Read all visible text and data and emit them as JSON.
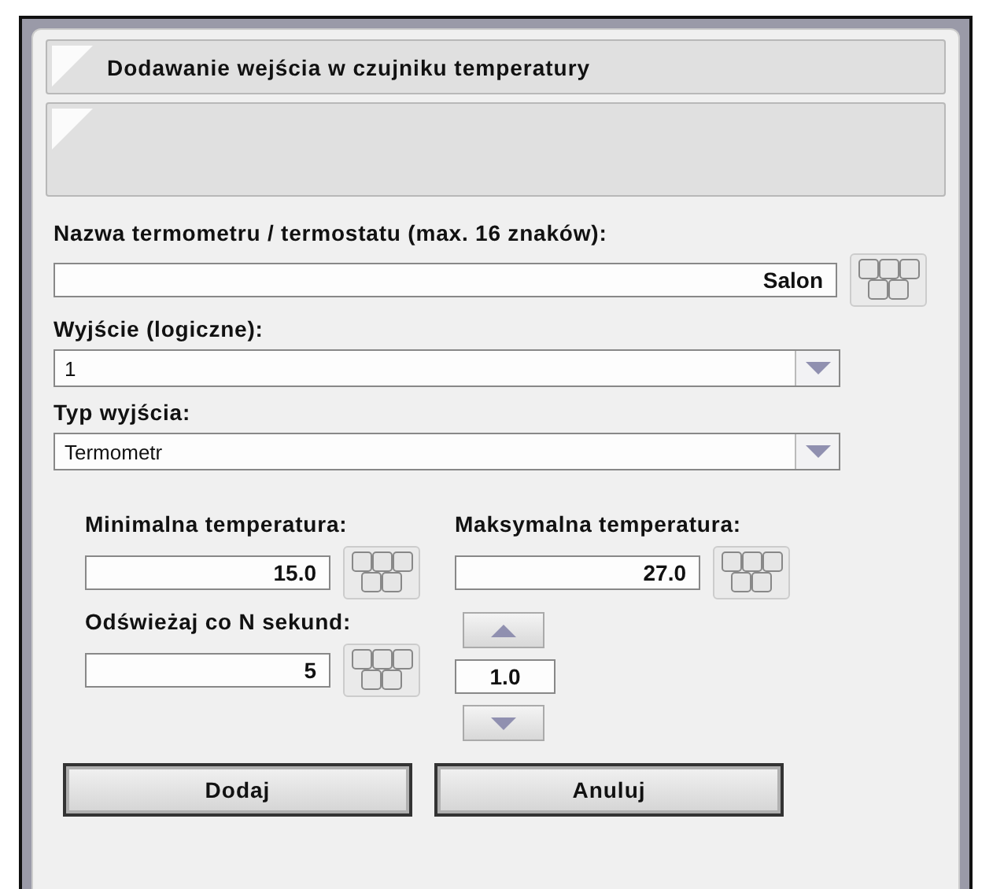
{
  "title": "Dodawanie wejścia w czujniku temperatury",
  "name_field": {
    "label": "Nazwa termometru / termostatu (max. 16 znaków):",
    "value": "Salon"
  },
  "selects": [
    {
      "label": "Wyjście (logiczne):",
      "value": "1"
    },
    {
      "label": "Typ wyjścia:",
      "value": "Termometr"
    }
  ],
  "min_temp": {
    "label": "Minimalna temperatura:",
    "value": "15.0"
  },
  "max_temp": {
    "label": "Maksymalna temperatura:",
    "value": "27.0"
  },
  "refresh": {
    "label": "Odświeżaj co N sekund:",
    "value": "5"
  },
  "step": {
    "value": "1.0"
  },
  "buttons": [
    "Dodaj",
    "Anuluj"
  ]
}
